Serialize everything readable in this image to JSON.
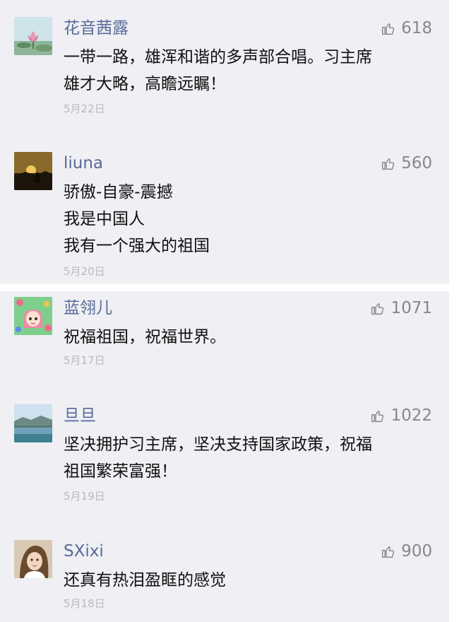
{
  "colors": {
    "background": "#efeff4",
    "separator": "#ffffff",
    "nickname": "#576b95",
    "body_text": "#111111",
    "meta_text": "#bbbbbb",
    "like_text": "#888888"
  },
  "comments": [
    {
      "nickname": "花音茜露",
      "avatar_icon": "lotus-flower-avatar",
      "like_icon": "thumbs-up-icon",
      "likes": "618",
      "lines": [
        "一带一路，雄浑和谐的多声部合唱。习主席",
        "雄才大略，高瞻远瞩！"
      ],
      "date": "5月22日"
    },
    {
      "nickname": "liuna",
      "avatar_icon": "sunset-avatar",
      "like_icon": "thumbs-up-icon",
      "likes": "560",
      "lines": [
        "骄傲-自豪-震撼",
        "我是中国人",
        "我有一个强大的祖国"
      ],
      "date": "5月20日"
    },
    {
      "nickname": "蓝翎儿",
      "avatar_icon": "cartoon-girl-avatar",
      "like_icon": "thumbs-up-icon",
      "likes": "1071",
      "lines": [
        "祝福祖国，祝福世界。"
      ],
      "date": "5月17日"
    },
    {
      "nickname": "旦旦",
      "avatar_icon": "lake-landscape-avatar",
      "like_icon": "thumbs-up-icon",
      "likes": "1022",
      "lines": [
        "坚决拥护习主席，坚决支持国家政策，祝福",
        "祖国繁荣富强！"
      ],
      "date": "5月19日"
    },
    {
      "nickname": "SXixi",
      "avatar_icon": "portrait-avatar",
      "like_icon": "thumbs-up-icon",
      "likes": "900",
      "lines": [
        "还真有热泪盈眶的感觉"
      ],
      "date": "5月18日"
    }
  ]
}
